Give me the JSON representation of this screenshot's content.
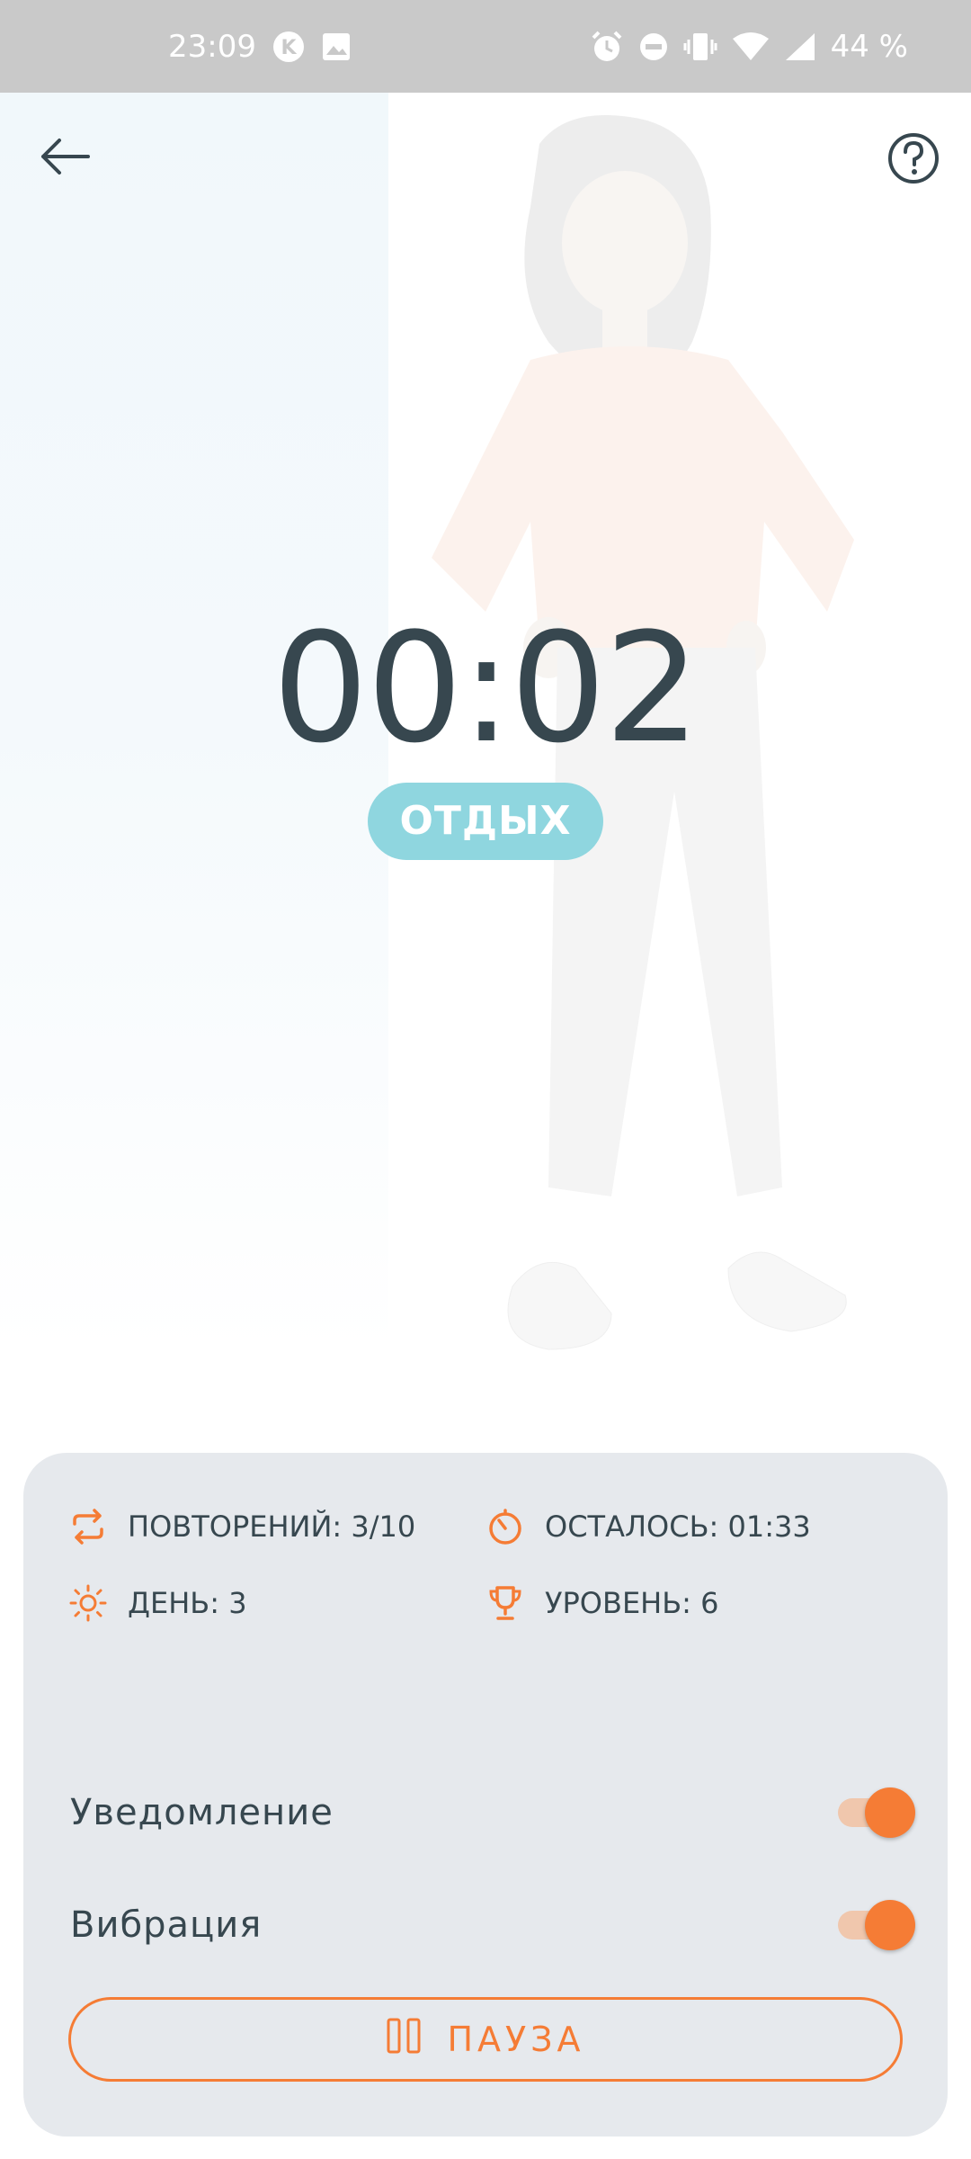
{
  "status_bar": {
    "time": "23:09",
    "battery": "44 %",
    "icons": [
      "k-app-icon",
      "image-icon",
      "alarm-icon",
      "dnd-icon",
      "vibrate-icon",
      "wifi-icon",
      "signal-icon"
    ]
  },
  "header": {
    "back_icon": "arrow-left-icon",
    "help_icon": "question-circle-icon"
  },
  "timer": {
    "value": "00:02",
    "phase": "ОТДЫХ"
  },
  "stats": {
    "repeats": "ПОВТОРЕНИЙ: 3/10",
    "remaining": "ОСТАЛОСЬ: 01:33",
    "day": "ДЕНЬ: 3",
    "level": "УРОВЕНЬ: 6"
  },
  "settings": {
    "notification_label": "Уведомление",
    "notification_on": true,
    "vibration_label": "Вибрация",
    "vibration_on": true
  },
  "pause_button": {
    "label": "ПАУЗА"
  },
  "colors": {
    "accent": "#f57c35",
    "rest_badge": "#8fd6df",
    "text": "#37474f",
    "card": "#e6e9ed"
  }
}
